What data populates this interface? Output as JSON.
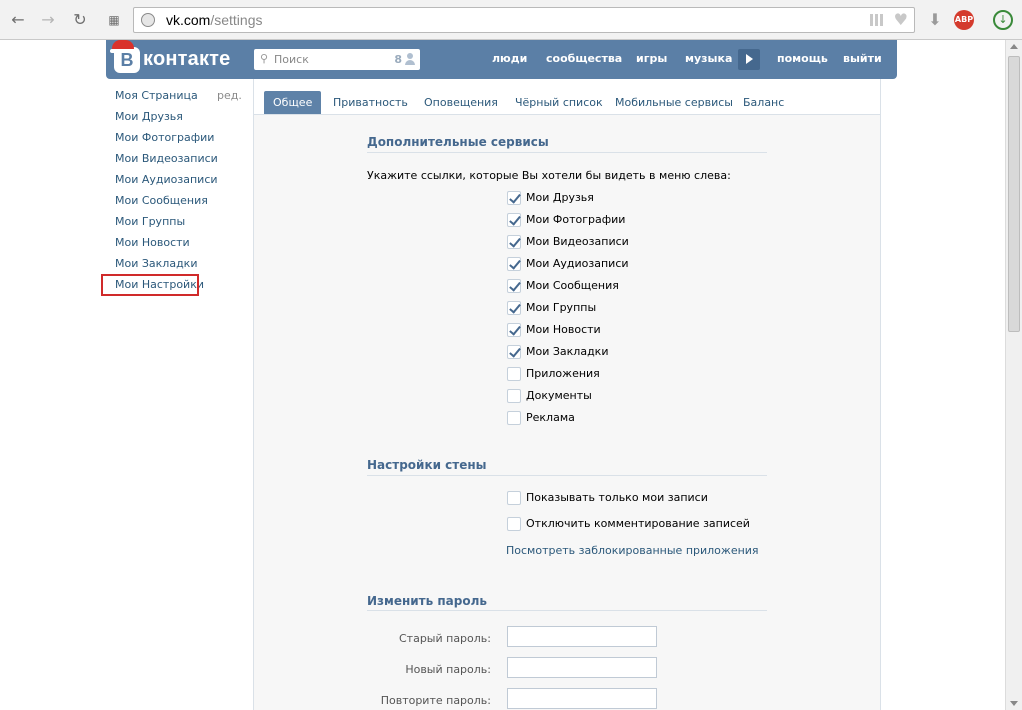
{
  "browser": {
    "url_host": "vk.com",
    "url_path": "/settings",
    "back_icon": "arrow-left",
    "forward_icon": "arrow-right",
    "reload_icon": "reload",
    "apps_icon": "apps-grid",
    "abp_label": "ABP"
  },
  "header": {
    "logo_letter": "В",
    "logo_word": "контакте",
    "search_placeholder": "Поиск",
    "search_count": "8",
    "nav": [
      "люди",
      "сообщества",
      "игры",
      "музыка",
      "помощь",
      "выйти"
    ]
  },
  "left_menu": {
    "edit_label": "ред.",
    "items": [
      "Моя Страница",
      "Мои Друзья",
      "Мои Фотографии",
      "Мои Видеозаписи",
      "Мои Аудиозаписи",
      "Мои Сообщения",
      "Мои Группы",
      "Мои Новости",
      "Мои Закладки",
      "Мои Настройки"
    ]
  },
  "tabs": [
    "Общее",
    "Приватность",
    "Оповещения",
    "Чёрный список",
    "Мобильные сервисы",
    "Баланс"
  ],
  "services": {
    "title": "Дополнительные сервисы",
    "hint": "Укажите ссылки, которые Вы хотели бы видеть в меню слева:",
    "items": [
      {
        "label": "Мои Друзья",
        "checked": true
      },
      {
        "label": "Мои Фотографии",
        "checked": true
      },
      {
        "label": "Мои Видеозаписи",
        "checked": true
      },
      {
        "label": "Мои Аудиозаписи",
        "checked": true
      },
      {
        "label": "Мои Сообщения",
        "checked": true
      },
      {
        "label": "Мои Группы",
        "checked": true
      },
      {
        "label": "Мои Новости",
        "checked": true
      },
      {
        "label": "Мои Закладки",
        "checked": true
      },
      {
        "label": "Приложения",
        "checked": false
      },
      {
        "label": "Документы",
        "checked": false
      },
      {
        "label": "Реклама",
        "checked": false
      }
    ]
  },
  "wall": {
    "title": "Настройки стены",
    "items": [
      {
        "label": "Показывать только мои записи",
        "checked": false
      },
      {
        "label": "Отключить комментирование записей",
        "checked": false
      }
    ],
    "blocked_apps_link": "Посмотреть заблокированные приложения"
  },
  "password": {
    "title": "Изменить пароль",
    "old_label": "Старый пароль:",
    "new_label": "Новый пароль:",
    "repeat_label": "Повторите пароль:",
    "old_value": "",
    "new_value": "",
    "repeat_value": ""
  },
  "colors": {
    "vk_blue": "#5b7fa6",
    "link": "#2b587a",
    "section_title": "#45688e",
    "highlight": "#d02a2a"
  }
}
